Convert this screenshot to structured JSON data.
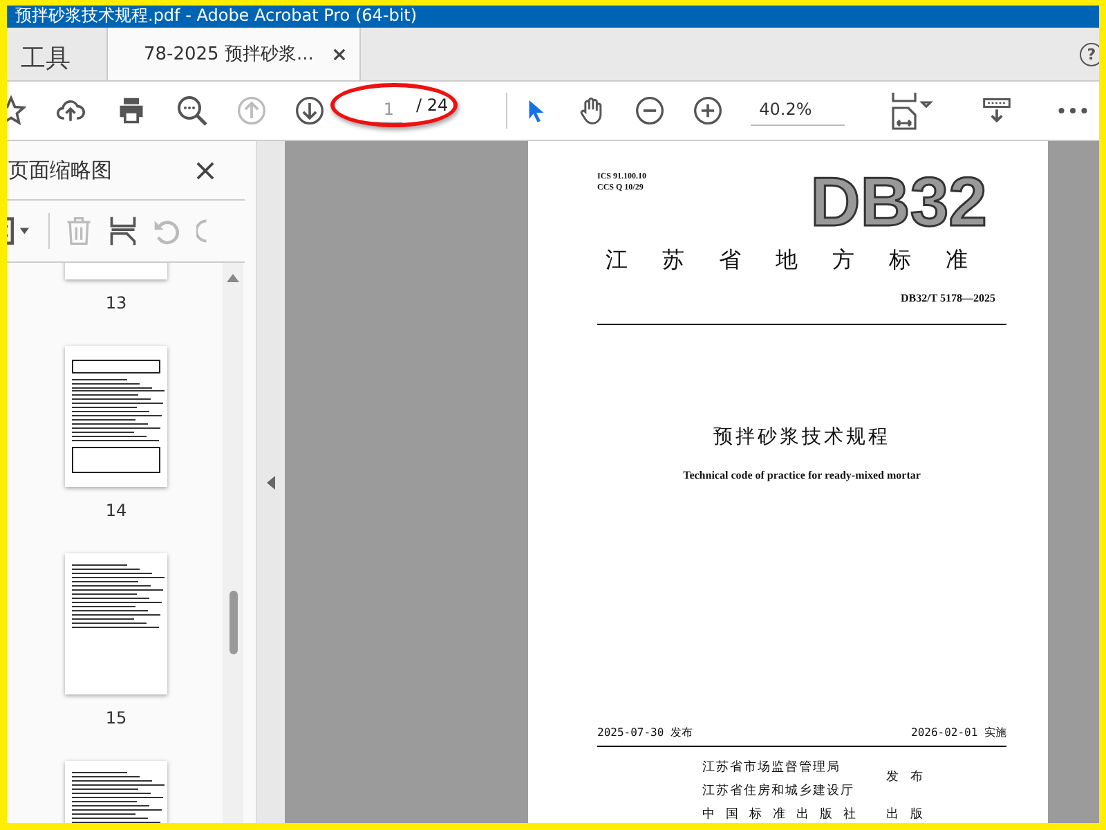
{
  "window": {
    "title": "预拌砂浆技术规程.pdf - Adobe Acrobat Pro (64-bit)"
  },
  "tabs": [
    {
      "label": "工具",
      "selected": false
    },
    {
      "label": "78-2025 预拌砂浆...",
      "selected": true
    }
  ],
  "help": "?",
  "toolbar": {
    "tools": [
      {
        "kind": "star",
        "disabled": false
      },
      {
        "kind": "upload",
        "disabled": false
      },
      {
        "kind": "print",
        "disabled": false
      },
      {
        "kind": "search",
        "disabled": false
      },
      {
        "kind": "prev",
        "disabled": true
      },
      {
        "kind": "next",
        "disabled": false
      }
    ],
    "page_field": {
      "value": "1",
      "total": "/ 24"
    },
    "view_tools": [
      {
        "kind": "select",
        "selected": true
      },
      {
        "kind": "hand",
        "selected": false
      }
    ],
    "zoom_tools": [
      {
        "kind": "zoom-out"
      },
      {
        "kind": "zoom-in"
      }
    ],
    "zoom_field": {
      "value": "40.2%"
    },
    "end_tools": [
      {
        "kind": "fit"
      },
      {
        "kind": "scroll"
      },
      {
        "kind": "more"
      }
    ]
  },
  "sidebar": {
    "title": "页面缩略图",
    "tools": [
      {
        "kind": "options",
        "disabled": false
      },
      {
        "kind": "delete",
        "disabled": true
      },
      {
        "kind": "insert",
        "disabled": false
      },
      {
        "kind": "rotate-left",
        "disabled": true
      },
      {
        "kind": "rotate-right",
        "disabled": true
      }
    ],
    "thumbnails": [
      {
        "label": "13",
        "kind": "partial-top"
      },
      {
        "label": "14",
        "kind": "table"
      },
      {
        "label": "15",
        "kind": "text"
      },
      {
        "kind": "partial-bottom"
      }
    ]
  },
  "document": {
    "ics": "ICS 91.100.10",
    "ccs": "CCS Q 10/29",
    "logo": "DB32",
    "category": "江苏省地方标准",
    "standard_no": "DB32/T 5178—2025",
    "title": "预拌砂浆技术规程",
    "title_en": "Technical code of practice for ready-mixed mortar",
    "issue_date": "2025-07-30 发布",
    "effective_date": "2026-02-01 实施",
    "issuers": [
      "江苏省市场监督管理局",
      "江苏省住房和城乡建设厅"
    ],
    "issue_label": "发 布",
    "publisher": "中国标准出版社",
    "publish_label": "出 版"
  }
}
